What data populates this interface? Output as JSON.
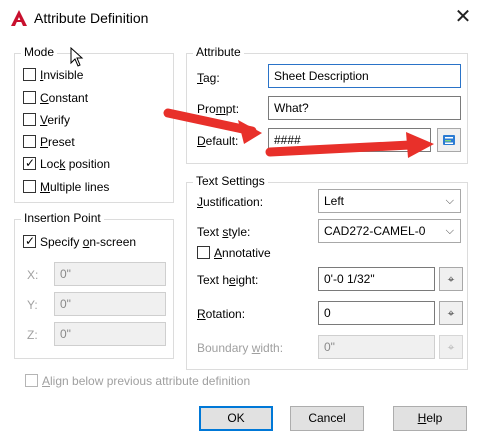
{
  "window": {
    "title": "Attribute Definition",
    "close_glyph": "✕",
    "app_icon": "autocad-logo-icon",
    "accent": "#c8102e"
  },
  "mode": {
    "group_title": "Mode",
    "items": [
      {
        "label": "Invisible",
        "checked": false
      },
      {
        "label": "Constant",
        "checked": false
      },
      {
        "label": "Verify",
        "checked": false
      },
      {
        "label": "Preset",
        "checked": false
      },
      {
        "label": "Lock position",
        "checked": true
      },
      {
        "label": "Multiple lines",
        "checked": false
      }
    ]
  },
  "insertion": {
    "group_title": "Insertion Point",
    "specify_label": "Specify on-screen",
    "specify_checked": true,
    "x_label": "X:",
    "x_value": "0\"",
    "y_label": "Y:",
    "y_value": "0\"",
    "z_label": "Z:",
    "z_value": "0\""
  },
  "attribute": {
    "group_title": "Attribute",
    "tag_label": "Tag:",
    "tag_value": "Sheet Description",
    "prompt_label": "Prompt:",
    "prompt_value": "What?",
    "default_label": "Default:",
    "default_value": "####",
    "insert_field_icon": "insert-field-icon"
  },
  "text_settings": {
    "group_title": "Text Settings",
    "justification_label": "Justification:",
    "justification_value": "Left",
    "style_label": "Text style:",
    "style_value": "CAD272-CAMEL-0",
    "annotative_label": "Annotative",
    "annotative_checked": false,
    "height_label": "Text height:",
    "height_value": "0'-0 1/32\"",
    "rotation_label": "Rotation:",
    "rotation_value": "0",
    "boundary_label": "Boundary width:",
    "boundary_value": "0\""
  },
  "align_below": {
    "label": "Align below previous attribute definition",
    "checked": false
  },
  "buttons": {
    "ok": "OK",
    "cancel": "Cancel",
    "help": "Help"
  },
  "annotation_color": "#e8302a"
}
